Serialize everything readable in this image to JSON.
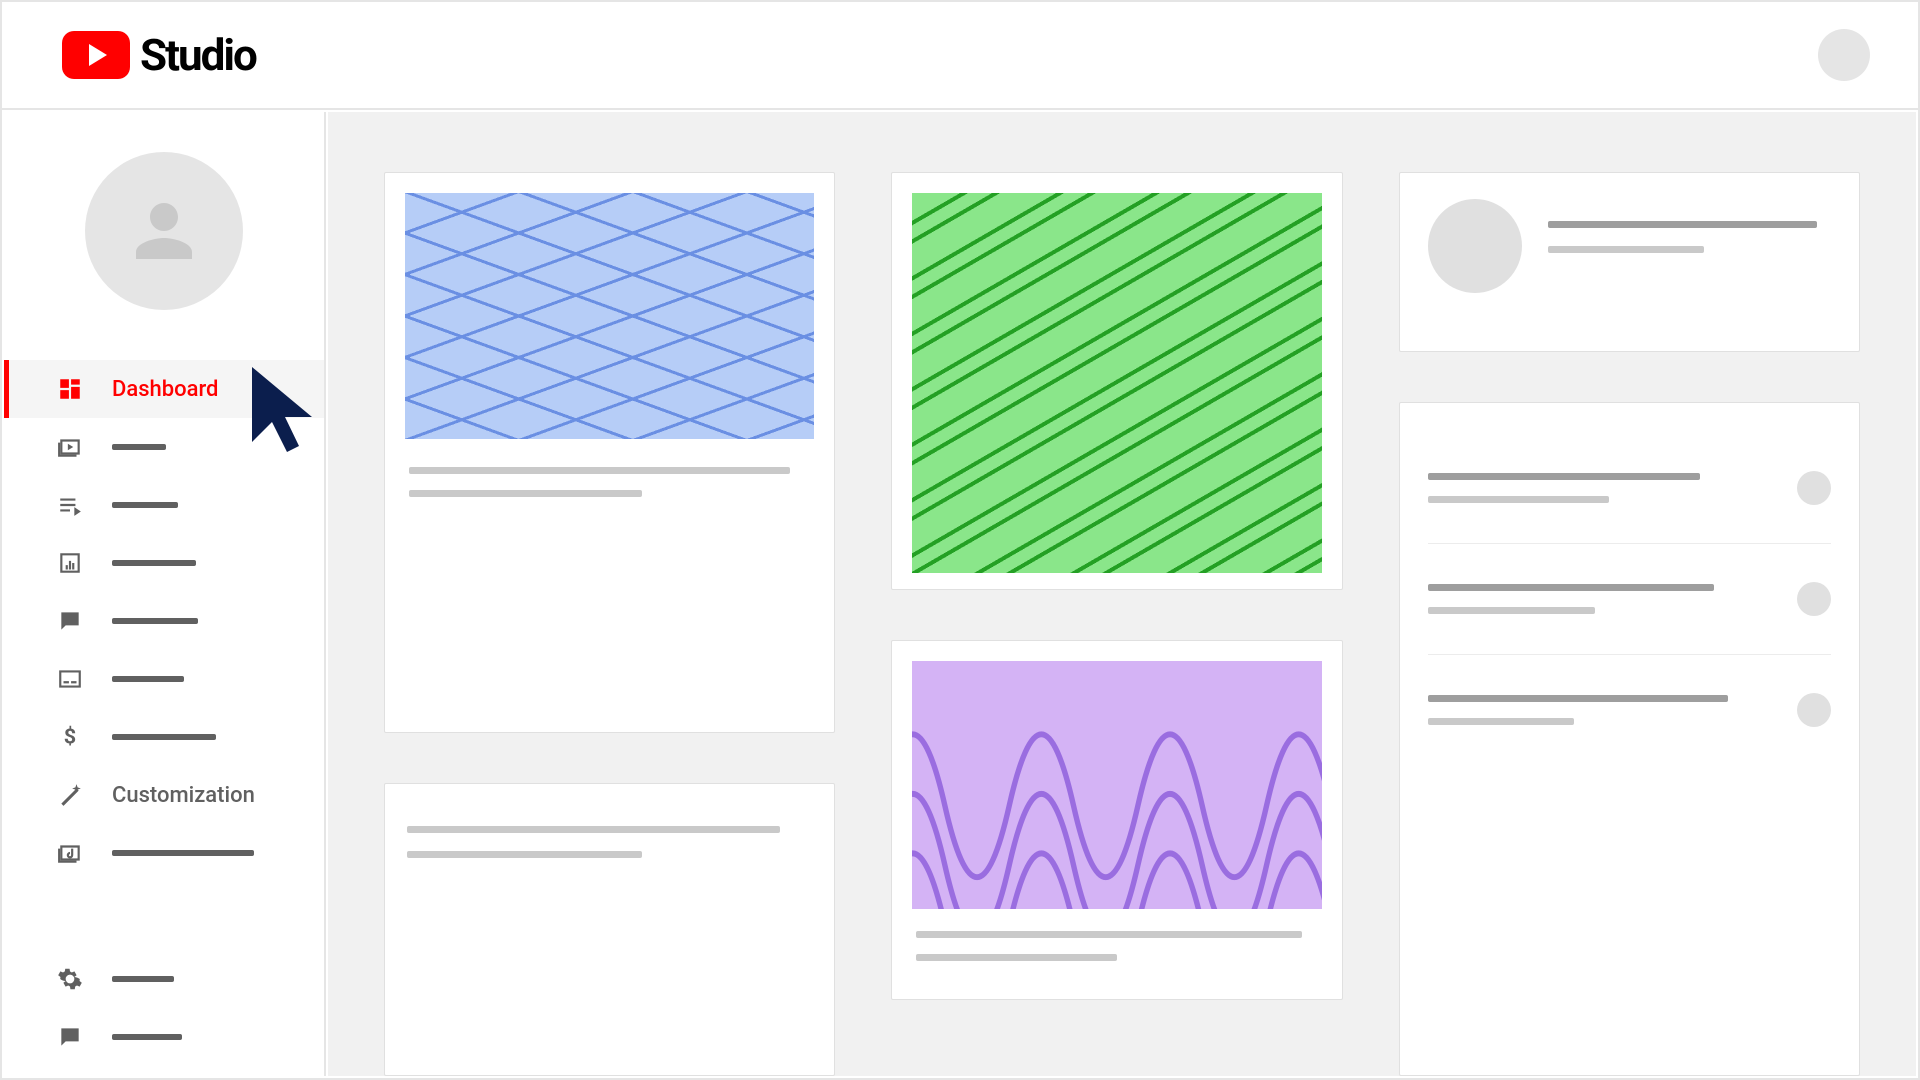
{
  "header": {
    "product_name": "Studio"
  },
  "sidebar": {
    "items": [
      {
        "id": "dashboard",
        "icon": "dashboard-icon",
        "label": "Dashboard",
        "stub_w": 0,
        "active": true
      },
      {
        "id": "content",
        "icon": "content-icon",
        "label": "",
        "stub_w": 54
      },
      {
        "id": "playlists",
        "icon": "playlist-icon",
        "label": "",
        "stub_w": 66
      },
      {
        "id": "analytics",
        "icon": "analytics-icon",
        "label": "",
        "stub_w": 84
      },
      {
        "id": "comments",
        "icon": "comments-icon",
        "label": "",
        "stub_w": 86
      },
      {
        "id": "subtitles",
        "icon": "subtitles-icon",
        "label": "",
        "stub_w": 72
      },
      {
        "id": "monetization",
        "icon": "monetization-icon",
        "label": "",
        "stub_w": 104
      },
      {
        "id": "customization",
        "icon": "magic-wand-icon",
        "label": "Customization",
        "stub_w": 0
      },
      {
        "id": "audio",
        "icon": "audio-library-icon",
        "label": "",
        "stub_w": 142
      }
    ],
    "footer": [
      {
        "id": "settings",
        "icon": "settings-icon",
        "stub_w": 62
      },
      {
        "id": "feedback",
        "icon": "feedback-icon",
        "stub_w": 70
      }
    ]
  }
}
